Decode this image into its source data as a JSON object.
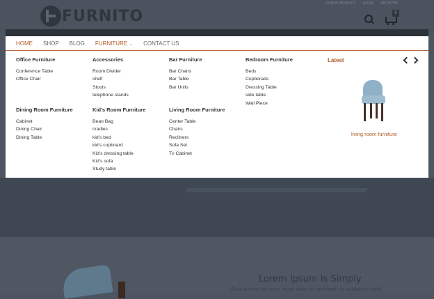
{
  "header": {
    "logo_text": "FURNITO",
    "top_links": [
      "PURSE PRODUCT",
      "LOGIN",
      "REGISTER"
    ],
    "cart_count": "0"
  },
  "nav": {
    "items": [
      "HOME",
      "SHOP",
      "BLOG",
      "FURNITURE",
      "CONTACT US"
    ],
    "active": "HOME"
  },
  "columns": [
    {
      "title": "Office Furniture",
      "items": [
        "Conference Table",
        "Office Chair"
      ]
    },
    {
      "title": "Accessories",
      "items": [
        "Room Divider",
        "shelf",
        "Stools",
        "telephone stands"
      ]
    },
    {
      "title": "Bar Furniture",
      "items": [
        "Bar Chairs",
        "Bar Table",
        "Bar Units"
      ]
    },
    {
      "title": "Bedroom Furniture",
      "items": [
        "Beds",
        "Cupborads",
        "Dressing Table",
        "side table",
        "Wall Piece"
      ]
    },
    {
      "title": "Dining Room Furniture",
      "items": [
        "Cabinet",
        "Dining Chair",
        "Dining Table"
      ]
    },
    {
      "title": "Kid's Room Furniture",
      "items": [
        "Bean Bag",
        "cradles",
        "kid's bed",
        "kid's cupboard",
        "Kid's dressing table",
        "Kid's sofa",
        "Study table"
      ]
    },
    {
      "title": "Living Room Furniture",
      "items": [
        "Center Table",
        "Chairs",
        "Recliners",
        "Sofa Set",
        "Tv Cabinet"
      ]
    }
  ],
  "latest": {
    "title": "Latest",
    "caption": "living room furniture"
  },
  "hero_below": {
    "title": "Lorem Ipsum Is Simply",
    "subtitle": "Duis autem vel eum iriure dolor in hendrerit in vulputate velit"
  },
  "colors": {
    "accent": "#b05b25",
    "overlay": "#4c5560"
  }
}
